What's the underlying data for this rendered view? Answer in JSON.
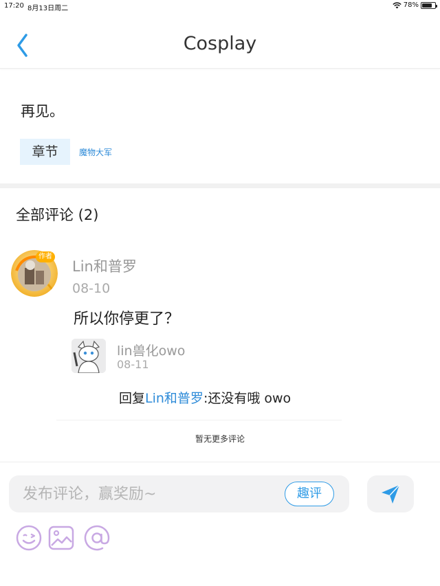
{
  "status_bar": {
    "time": "17:20",
    "date": "8月13日周二",
    "battery": "78%",
    "battery_level": 0.78
  },
  "header": {
    "title": "Cosplay",
    "back_icon": "chevron-left-icon"
  },
  "post": {
    "text": "再见。",
    "chapter_tag": "章节",
    "chapter_link": "魔物大军"
  },
  "comments": {
    "heading": "全部评论 (2)",
    "items": [
      {
        "user": "Lin和普罗",
        "badge": "作者",
        "date": "08-10",
        "body": "所以你停更了？",
        "replies": [
          {
            "user": "lin兽化owo",
            "date": "08-11",
            "reply_prefix": "回复",
            "mention": "Lin和普罗",
            "text": ":还没有哦 owo"
          }
        ]
      }
    ],
    "no_more": "暂无更多评论"
  },
  "composer": {
    "placeholder": "发布评论，赢奖励~",
    "fun_button": "趣评",
    "send_icon": "send-arrow-icon",
    "tools": [
      "emoji-icon",
      "image-icon",
      "mention-icon"
    ]
  },
  "colors": {
    "accent": "#2e9be6",
    "link": "#2e8bd8",
    "tool_icon": "#c8a8e3",
    "tag_bg": "#e6f3fd"
  }
}
